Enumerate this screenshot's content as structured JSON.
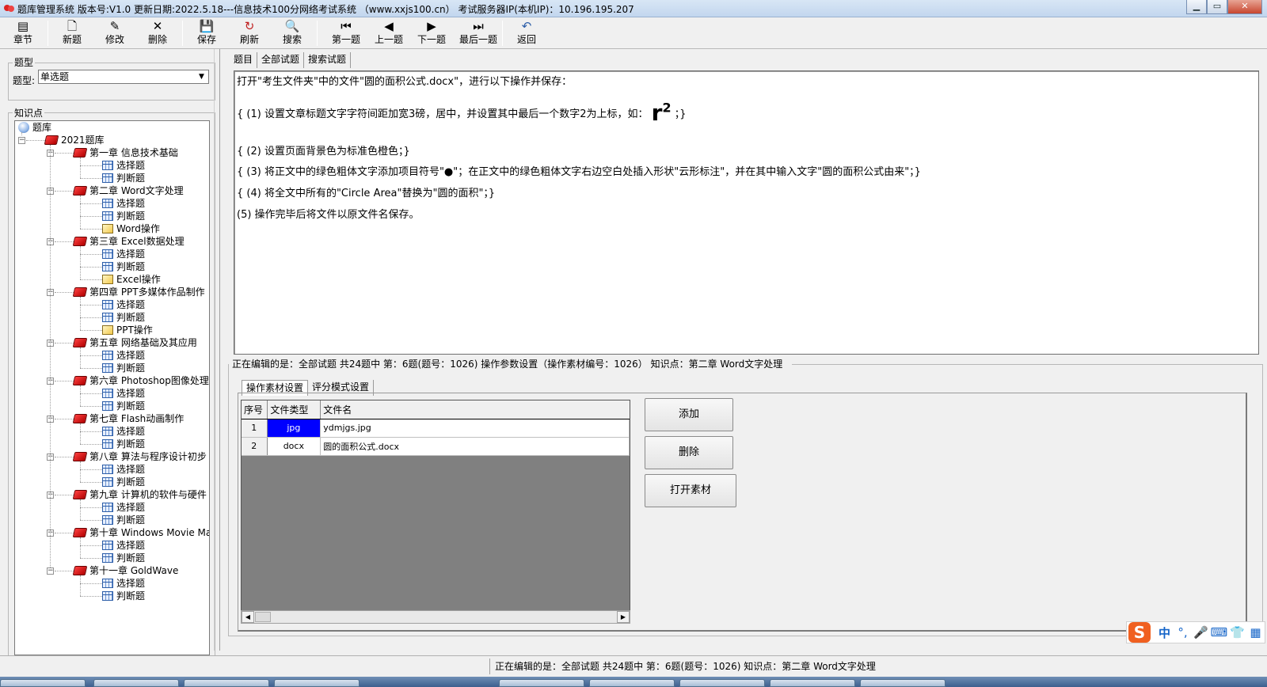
{
  "window": {
    "title": "题库管理系统 版本号:V1.0 更新日期:2022.5.18---信息技术100分网络考试系统  （www.xxjs100.cn） 考试服务器IP(本机IP)：10.196.195.207",
    "controls": {
      "minimize": "▁",
      "maximize": "▭",
      "close": "✕"
    }
  },
  "toolbar": {
    "buttons": [
      {
        "label": "章节",
        "icon": "chapters-icon",
        "glyph": "▤"
      },
      {
        "label": "新题",
        "icon": "new-icon",
        "glyph": "🗋"
      },
      {
        "label": "修改",
        "icon": "edit-icon",
        "glyph": "✎"
      },
      {
        "label": "删除",
        "icon": "delete-icon",
        "glyph": "✕"
      },
      {
        "label": "保存",
        "icon": "save-icon",
        "glyph": "💾"
      },
      {
        "label": "刷新",
        "icon": "refresh-icon",
        "glyph": "↻"
      },
      {
        "label": "搜索",
        "icon": "search-icon",
        "glyph": "🔍"
      },
      {
        "label": "第一题",
        "icon": "first-icon",
        "glyph": "⏮"
      },
      {
        "label": "上一题",
        "icon": "prev-icon",
        "glyph": "◀"
      },
      {
        "label": "下一题",
        "icon": "next-icon",
        "glyph": "▶"
      },
      {
        "label": "最后一题",
        "icon": "last-icon",
        "glyph": "⏭"
      },
      {
        "label": "返回",
        "icon": "back-icon",
        "glyph": "↶"
      }
    ]
  },
  "left": {
    "type_group_title": "题型",
    "type_label": "题型:",
    "type_value": "单选题",
    "knowledge_group_title": "知识点",
    "tree": {
      "root": "题库",
      "bank": "2021题库",
      "chapters": [
        {
          "label": "第一章 信息技术基础",
          "children": [
            "选择题",
            "判断题"
          ]
        },
        {
          "label": "第二章 Word文字处理",
          "children": [
            "选择题",
            "判断题",
            "Word操作"
          ]
        },
        {
          "label": "第三章 Excel数据处理",
          "children": [
            "选择题",
            "判断题",
            "Excel操作"
          ]
        },
        {
          "label": "第四章 PPT多媒体作品制作",
          "children": [
            "选择题",
            "判断题",
            "PPT操作"
          ]
        },
        {
          "label": "第五章 网络基础及其应用",
          "children": [
            "选择题",
            "判断题"
          ]
        },
        {
          "label": "第六章 Photoshop图像处理",
          "children": [
            "选择题",
            "判断题"
          ]
        },
        {
          "label": "第七章 Flash动画制作",
          "children": [
            "选择题",
            "判断题"
          ]
        },
        {
          "label": "第八章 算法与程序设计初步",
          "children": [
            "选择题",
            "判断题"
          ]
        },
        {
          "label": "第九章 计算机的软件与硬件",
          "children": [
            "选择题",
            "判断题"
          ]
        },
        {
          "label": "第十章 Windows Movie Make",
          "children": [
            "选择题",
            "判断题"
          ]
        },
        {
          "label": "第十一章 GoldWave",
          "children": [
            "选择题",
            "判断题"
          ]
        }
      ]
    }
  },
  "tabs": [
    "题目",
    "全部试题",
    "搜索试题"
  ],
  "question": {
    "lines": [
      "打开\"考生文件夹\"中的文件\"圆的面积公式.docx\"，进行以下操作并保存：",
      "{ (1) 设置文章标题文字字符间距加宽3磅，居中，并设置其中最后一个数字2为上标，如：",
      "{ (2)  设置页面背景色为标准色橙色；}",
      "{ (3)  将正文中的绿色粗体文字添加项目符号\"●\"；在正文中的绿色粗体文字右边空白处插入形状\"云形标注\"，并在其中输入文字\"圆的面积公式由来\"；}",
      "{ (4) 将全文中所有的\"Circle Area\"替换为\"圆的面积\"；}",
      "(5) 操作完毕后将文件以原文件名保存。"
    ],
    "example_base": "r",
    "example_sup": "2",
    "line1_tail": "；}"
  },
  "editing_status": "正在编辑的是：全部试题 共24题中  第：6题(题号：1026) 操作参数设置（操作素材编号：1026） 知识点：第二章 Word文字处理",
  "subtabs": [
    "操作素材设置",
    "评分模式设置"
  ],
  "files_table": {
    "headers": [
      "序号",
      "文件类型",
      "文件名"
    ],
    "rows": [
      {
        "no": "1",
        "type": "jpg",
        "name": "ydmjgs.jpg",
        "selected": true
      },
      {
        "no": "2",
        "type": "docx",
        "name": "圆的面积公式.docx",
        "selected": false
      }
    ]
  },
  "actions": {
    "add": "添加",
    "delete": "删除",
    "open": "打开素材"
  },
  "statusbar_text": "正在编辑的是：全部试题 共24题中  第：6题(题号：1026)  知识点：第二章 Word文字处理",
  "ime": {
    "logo": "S",
    "mode": "中",
    "punct": "°,",
    "mic": "🎤",
    "keyboard": "⌨",
    "skin": "👕",
    "tools": "▦"
  },
  "colors": {
    "selection": "#0000ff",
    "book_icon": "#cc0000"
  }
}
